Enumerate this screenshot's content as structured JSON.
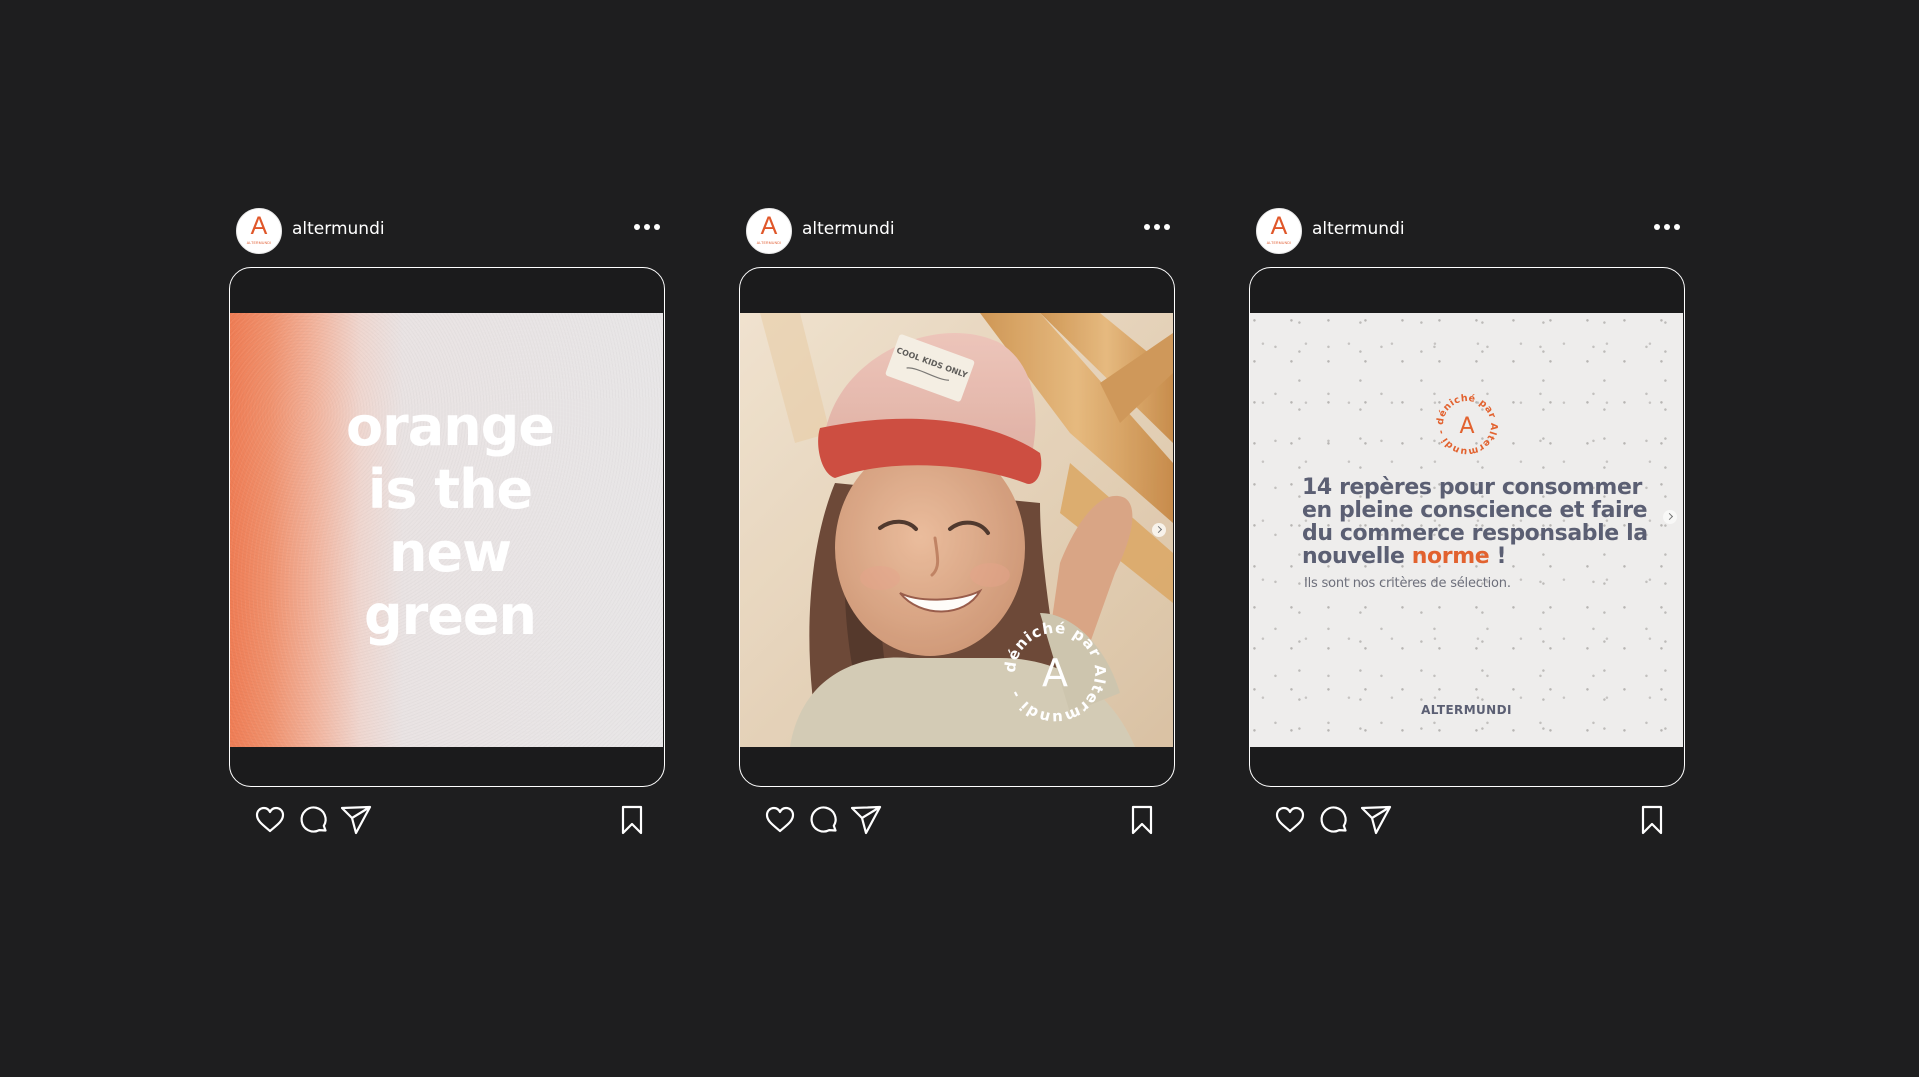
{
  "colors": {
    "background": "#1e1e1f",
    "brand_orange": "#e0572a",
    "frame_stroke": "#ffffff",
    "headline_slate": "#5b5f73"
  },
  "posts": [
    {
      "username": "altermundi",
      "avatar": {
        "letter": "A",
        "word": "ALTERMUNDI"
      },
      "headline_lines": [
        "orange",
        "is the",
        "new",
        "green"
      ]
    },
    {
      "username": "altermundi",
      "avatar": {
        "letter": "A",
        "word": "ALTERMUNDI"
      },
      "cap_label": "COOL KIDS ONLY",
      "seal": {
        "letter": "A",
        "ring_text": "déniché par Altermundi - "
      }
    },
    {
      "username": "altermundi",
      "avatar": {
        "letter": "A",
        "word": "ALTERMUNDI"
      },
      "seal": {
        "letter": "A",
        "ring_text": "déniché par Altermundi - "
      },
      "headline_before_accent": "14 repères pour consommer en pleine conscience et faire du commerce responsable la nouvelle ",
      "headline_accent": "norme",
      "headline_after_accent": " !",
      "subtitle": "Ils sont nos critères de sélection.",
      "brand": "ALTERMUNDI"
    }
  ],
  "icons": {
    "more": "more-horizontal-icon",
    "like": "heart-icon",
    "comment": "comment-icon",
    "share": "paper-plane-icon",
    "save": "bookmark-icon"
  }
}
